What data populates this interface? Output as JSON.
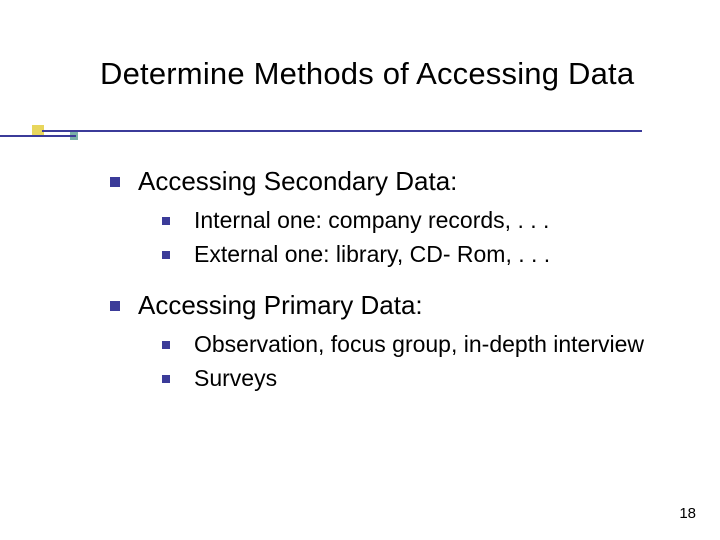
{
  "slide": {
    "title": "Determine Methods of Accessing Data",
    "page_number": "18",
    "sections": [
      {
        "heading": "Accessing Secondary Data:",
        "items": [
          "Internal one: company records, . . .",
          "External one: library, CD- Rom, . . ."
        ]
      },
      {
        "heading": "Accessing Primary Data:",
        "items": [
          "Observation, focus group, in-depth interview",
          "Surveys"
        ]
      }
    ]
  }
}
